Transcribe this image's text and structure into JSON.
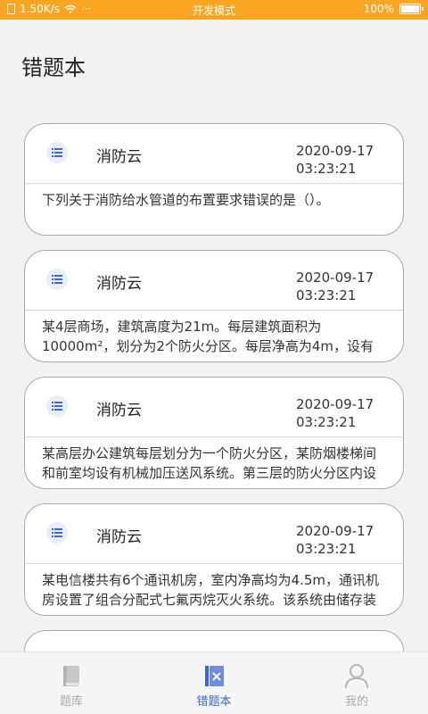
{
  "status_bar": {
    "speed": "1.50K/s",
    "dots": "···",
    "mode": "开发模式",
    "battery": "100%"
  },
  "page": {
    "title": "错题本"
  },
  "cards": [
    {
      "source": "消防云",
      "date": "2020-09-17",
      "time": "03:23:21",
      "text": "下列关于消防给水管道的布置要求错误的是（）。"
    },
    {
      "source": "消防云",
      "date": "2020-09-17",
      "time": "03:23:21",
      "text": "某4层商场，建筑高度为21m。每层建筑面积为10000m²，划分为2个防火分区。每层净高为4m，设有自动喷水灭火系统和火灾自动报警系统。"
    },
    {
      "source": "消防云",
      "date": "2020-09-17",
      "time": "03:23:21",
      "text": "某高层办公建筑每层划分为一个防火分区，某防烟楼梯间和前室均设有机械加压送风系统。第三层的防火分区内设有消防设备房。"
    },
    {
      "source": "消防云",
      "date": "2020-09-17",
      "time": "03:23:21",
      "text": "某电信楼共有6个通讯机房，室内净高均为4.5m，通讯机房设置了组合分配式七氟丙烷灭火系统。该系统由储存装置和管网组成。"
    }
  ],
  "tabs": [
    {
      "label": "题库",
      "icon": "book-icon",
      "active": false
    },
    {
      "label": "错题本",
      "icon": "wrong-book-icon",
      "active": true
    },
    {
      "label": "我的",
      "icon": "user-icon",
      "active": false
    }
  ],
  "colors": {
    "status_bar": "#fba623",
    "active_tab": "#3d66cf",
    "inactive_tab": "#aaaaaa"
  }
}
